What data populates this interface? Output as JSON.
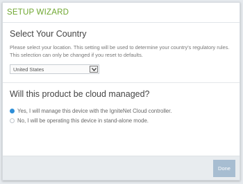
{
  "dialog": {
    "title": "SETUP WIZARD",
    "country_section": {
      "title": "Select Your Country",
      "description": "Please select your location. This setting will be used to determine your country's regulatory rules. This selection can only be changed if you reset to defaults.",
      "selected_country": "United States"
    },
    "cloud_section": {
      "question": "Will this product be cloud managed?",
      "options": [
        {
          "label": "Yes, I will manage this device with the IgniteNet Cloud controller.",
          "checked": true
        },
        {
          "label": "No, I will be operating this device in stand-alone mode.",
          "checked": false
        }
      ]
    },
    "footer": {
      "done_label": "Done"
    }
  },
  "colors": {
    "accent_green": "#6ea62f",
    "radio_selected": "#2f8fd8",
    "done_button": "#a7bdd1"
  },
  "icons": {
    "select_arrow": "chevron-down-icon"
  }
}
